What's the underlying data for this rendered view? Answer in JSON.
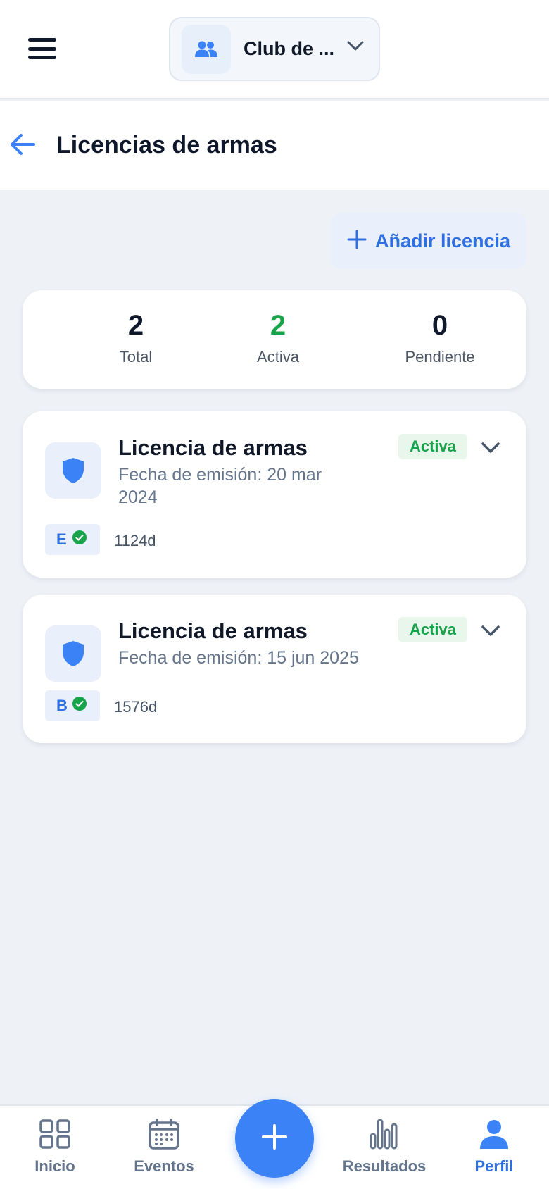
{
  "header": {
    "club_name": "Club de ...",
    "icons": {
      "menu": "hamburger-icon",
      "club": "users-icon",
      "dropdown": "chevron-down-icon"
    }
  },
  "page": {
    "title": "Licencias de armas",
    "back_icon": "arrow-left-icon"
  },
  "actions": {
    "add_license_label": "Añadir licencia",
    "add_icon": "plus-icon"
  },
  "stats": {
    "total": {
      "value": "2",
      "label": "Total"
    },
    "active": {
      "value": "2",
      "label": "Activa"
    },
    "pending": {
      "value": "0",
      "label": "Pendiente"
    }
  },
  "licenses": [
    {
      "title": "Licencia de armas",
      "issue_date": "Fecha de emisión: 20 mar 2024",
      "status": "Activa",
      "category": "E",
      "days": "1124d"
    },
    {
      "title": "Licencia de armas",
      "issue_date": "Fecha de emisión: 15 jun 2025",
      "status": "Activa",
      "category": "B",
      "days": "1576d"
    }
  ],
  "nav": {
    "items": [
      {
        "label": "Inicio",
        "icon": "grid-icon"
      },
      {
        "label": "Eventos",
        "icon": "calendar-icon"
      },
      {
        "label": "Resultados",
        "icon": "bar-chart-icon"
      },
      {
        "label": "Perfil",
        "icon": "user-icon"
      }
    ],
    "fab_icon": "plus-icon",
    "active": "Perfil"
  },
  "colors": {
    "accent": "#3b82f6",
    "accent_text": "#2f6fe0",
    "success": "#16a34a",
    "background": "#eef2f7"
  }
}
